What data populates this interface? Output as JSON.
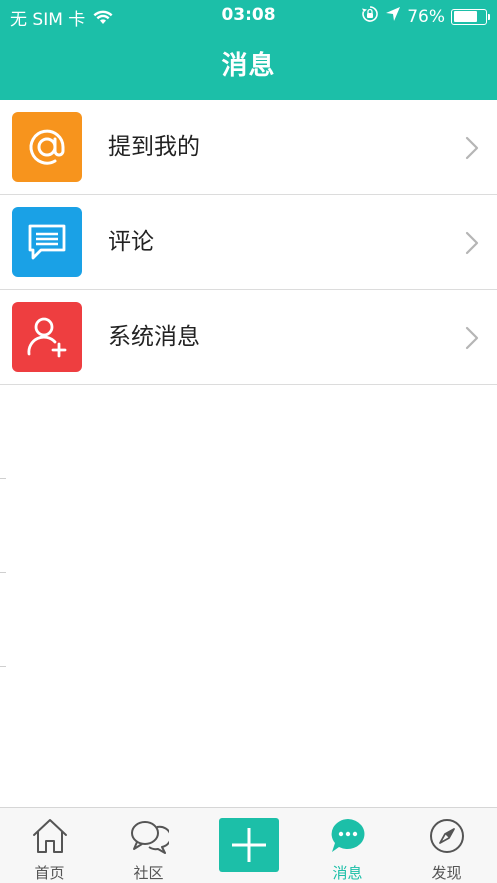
{
  "status_bar": {
    "carrier": "无 SIM 卡",
    "time": "03:08",
    "battery": "76%",
    "battery_level": 0.76
  },
  "nav": {
    "title": "消息"
  },
  "list": {
    "items": [
      {
        "label": "提到我的",
        "icon": "at-icon",
        "color": "#f7941d"
      },
      {
        "label": "评论",
        "icon": "comment-icon",
        "color": "#1aa1e6"
      },
      {
        "label": "系统消息",
        "icon": "add-user-icon",
        "color": "#ee3e40"
      }
    ]
  },
  "tabs": [
    {
      "label": "首页",
      "icon": "home-icon"
    },
    {
      "label": "社区",
      "icon": "community-icon"
    },
    {
      "label": "",
      "icon": "plus-icon"
    },
    {
      "label": "消息",
      "icon": "message-icon",
      "active": true
    },
    {
      "label": "发现",
      "icon": "compass-icon"
    }
  ],
  "colors": {
    "brand": "#1cbfa8",
    "text": "#222222",
    "tab_text": "#555555"
  }
}
